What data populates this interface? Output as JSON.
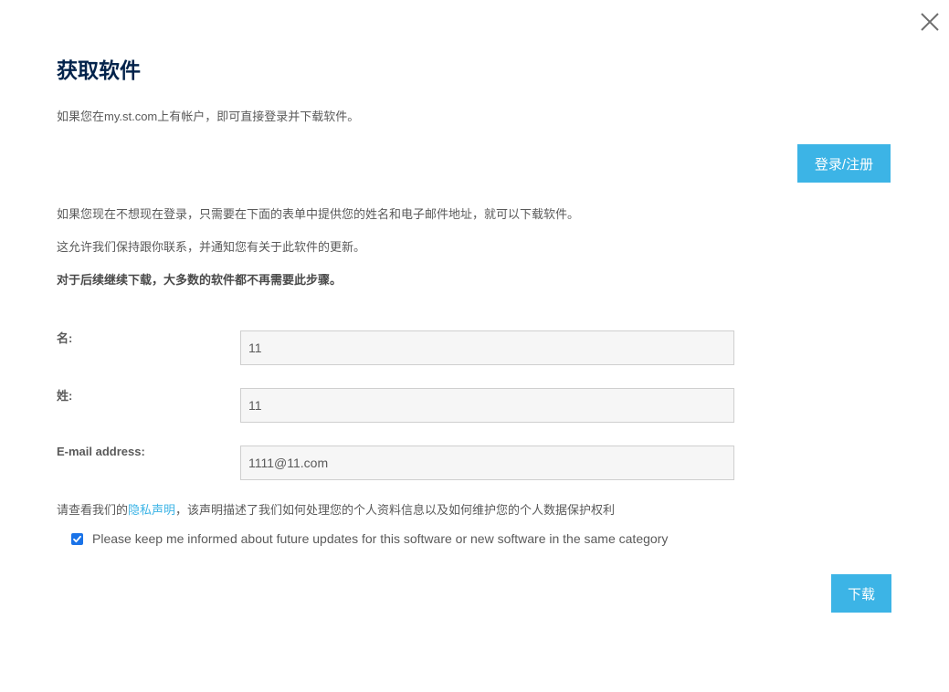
{
  "dialog": {
    "title": "获取软件",
    "intro_text": "如果您在my.st.com上有帐户，即可直接登录并下载软件。",
    "login_button_label": "登录/注册",
    "guest_text": "如果您现在不想现在登录，只需要在下面的表单中提供您的姓名和电子邮件地址，就可以下载软件。",
    "contact_text": "这允许我们保持跟你联系，并通知您有关于此软件的更新。",
    "note_text": "对于后续继续下载，大多数的软件都不再需要此步骤。"
  },
  "form": {
    "first_name": {
      "label": "名:",
      "value": "11"
    },
    "last_name": {
      "label": "姓:",
      "value": "11"
    },
    "email": {
      "label": "E-mail address:",
      "value": "1111@11.com"
    }
  },
  "privacy": {
    "prefix": "请查看我们的",
    "link_text": "隐私声明",
    "suffix": "，该声明描述了我们如何处理您的个人资料信息以及如何维护您的个人数据保护权利"
  },
  "newsletter": {
    "checked": true,
    "label": "Please keep me informed about future updates for this software or new software in the same category"
  },
  "download_button_label": "下载",
  "colors": {
    "accent": "#3cb4e6",
    "title": "#03234b",
    "checkbox": "#1a73e8"
  },
  "icons": {
    "close": "close-icon",
    "check": "check-icon"
  }
}
